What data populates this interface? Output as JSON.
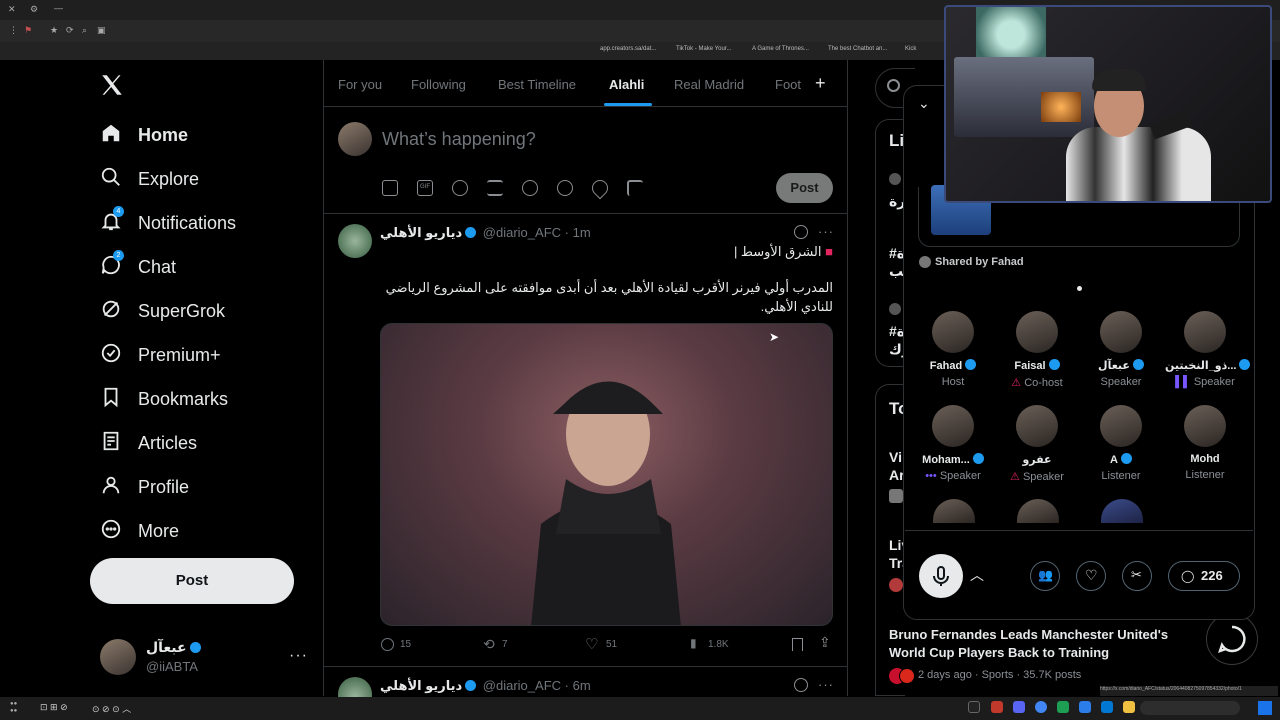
{
  "browser": {
    "bookmarks": [
      "app.creators.sa/dat...",
      "TikTok - Make Your...",
      "A Game of Thrones...",
      "The best Chatbot an...",
      "Kick"
    ],
    "status_url": "https://x.com/diario_AFC/status/2064408275097854332/photo/1"
  },
  "nav": {
    "items": [
      {
        "label": "Home",
        "icon": "home-icon",
        "badge": ""
      },
      {
        "label": "Explore",
        "icon": "search-icon",
        "badge": ""
      },
      {
        "label": "Notifications",
        "icon": "bell-icon",
        "badge": "4"
      },
      {
        "label": "Chat",
        "icon": "chat-icon",
        "badge": "2"
      },
      {
        "label": "SuperGrok",
        "icon": "grok-icon",
        "badge": ""
      },
      {
        "label": "Premium+",
        "icon": "verified-icon",
        "badge": ""
      },
      {
        "label": "Bookmarks",
        "icon": "bookmark-icon",
        "badge": ""
      },
      {
        "label": "Articles",
        "icon": "article-icon",
        "badge": ""
      },
      {
        "label": "Profile",
        "icon": "person-icon",
        "badge": ""
      },
      {
        "label": "More",
        "icon": "more-circle-icon",
        "badge": ""
      }
    ],
    "post_label": "Post",
    "account_name": "عبعآل",
    "account_handle": "@iiABTA"
  },
  "tabs": [
    "For you",
    "Following",
    "Best Timeline",
    "Alahli",
    "Real Madrid",
    "Foot"
  ],
  "active_tab": "Alahli",
  "composer": {
    "placeholder": "What’s happening?",
    "post_label": "Post"
  },
  "tweet": {
    "name": "دياريو الأهلي",
    "handle": "@diario_AFC",
    "time": "· 1m",
    "source": "الشرق الأوسط |",
    "text": "المدرب أولي فيرنر الأقرب لقيادة الأهلي بعد أن أبدى موافقته على المشروع الرياضي للنادي الأهلي.",
    "replies": "15",
    "reposts": "7",
    "likes": "51",
    "views": "1.8K"
  },
  "tweet2": {
    "name": "دياريو الأهلي",
    "handle": "@diario_AFC",
    "time": "· 6m"
  },
  "sidebar": {
    "live_label": "Li",
    "trend_fragments": [
      "يرة",
      "#ة",
      "لب",
      "#ة",
      "رك"
    ],
    "todays_label": "To",
    "news_fragments": [
      "Vi",
      "Ar",
      "Liv",
      "Tra"
    ],
    "news_title": "Bruno Fernandes Leads Manchester United's World Cup Players Back to Training",
    "news_meta": "2 days ago · Sports · 35.7K posts"
  },
  "space": {
    "shared_by": "Shared by Fahad",
    "participants": [
      {
        "name": "Fahad",
        "role": "Host",
        "verified": true
      },
      {
        "name": "Faisal",
        "role": "Co-host",
        "verified": true
      },
      {
        "name": "عبعآل",
        "role": "Speaker",
        "verified": true
      },
      {
        "name": "ذو_النخبتين...",
        "role": "Speaker",
        "verified": true
      },
      {
        "name": "Moham...",
        "role": "Speaker",
        "verified": true
      },
      {
        "name": "عفرو",
        "role": "Speaker",
        "verified": false
      },
      {
        "name": "A",
        "role": "Listener",
        "verified": true
      },
      {
        "name": "Mohd",
        "role": "Listener",
        "verified": false
      }
    ],
    "comment_count": "226"
  },
  "colors": {
    "accent": "#1d9bf0",
    "background": "#000000",
    "border": "#2f3336",
    "muted": "#71767b",
    "muted_role": "#e0245e"
  }
}
